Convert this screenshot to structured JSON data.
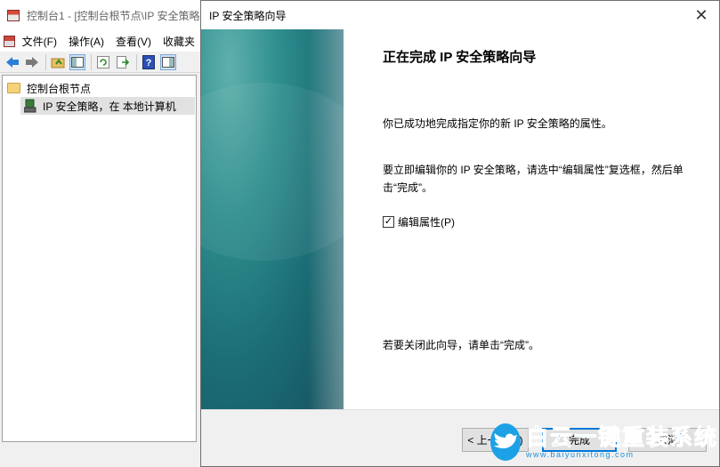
{
  "mmc": {
    "title": "控制台1 - [控制台根节点\\IP 安全策略",
    "menu": [
      "文件(F)",
      "操作(A)",
      "查看(V)",
      "收藏夹"
    ],
    "tree": {
      "root": "控制台根节点",
      "child": "IP 安全策略，在 本地计算机"
    }
  },
  "wizard": {
    "title": "IP 安全策略向导",
    "heading": "正在完成 IP 安全策略向导",
    "p1": "你已成功地完成指定你的新 IP 安全策略的属性。",
    "p2": "要立即编辑你的 IP 安全策略，请选中“编辑属性”复选框，然后单击“完成”。",
    "checkbox_label": "编辑属性(P)",
    "checkbox_checked": true,
    "p3": "若要关闭此向导，请单击“完成”。",
    "buttons": {
      "back": "< 上一步(B)",
      "finish": "完成",
      "cancel": "取消"
    }
  },
  "watermark": {
    "main": "白云一键重装系统",
    "url": "www.baiyunxitong.com"
  },
  "colors": {
    "accent": "#0078d7",
    "banner": "#1c6f77",
    "watermark": "#1e90d9"
  }
}
